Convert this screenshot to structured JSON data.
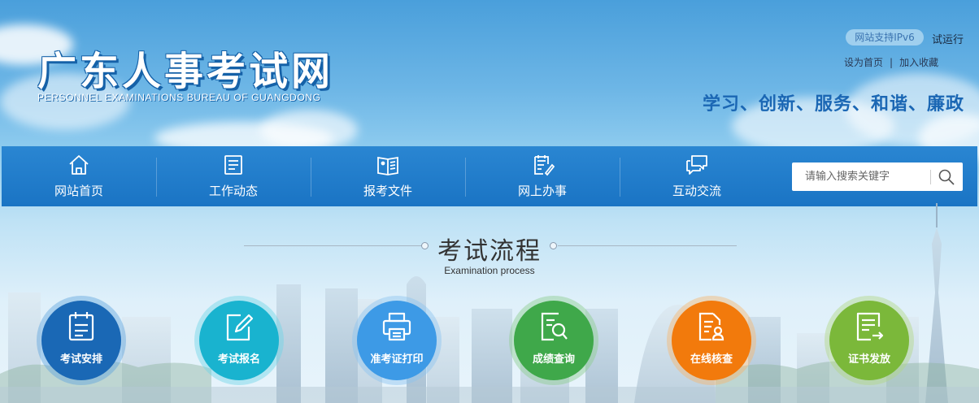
{
  "header": {
    "logo_cn": "广东人事考试网",
    "logo_en": "PERSONNEL EXAMINATIONS BUREAU OF GUANGDONG",
    "ipv6_badge": "网站支持IPv6",
    "trial": "试运行",
    "links": [
      {
        "label": "设为首页"
      },
      {
        "label": "加入收藏"
      }
    ],
    "link_separator": "|",
    "slogan": "学习、创新、服务、和谐、廉政"
  },
  "nav": {
    "items": [
      {
        "label": "网站首页",
        "icon": "home-icon"
      },
      {
        "label": "工作动态",
        "icon": "news-icon"
      },
      {
        "label": "报考文件",
        "icon": "document-icon"
      },
      {
        "label": "网上办事",
        "icon": "online-service-icon"
      },
      {
        "label": "互动交流",
        "icon": "chat-icon"
      }
    ],
    "search": {
      "placeholder": "请输入搜索关键字",
      "value": ""
    }
  },
  "section": {
    "title": "考试流程",
    "subtitle": "Examination process"
  },
  "process": {
    "steps": [
      {
        "label": "考试安排",
        "icon": "calendar-icon",
        "color": "#1a68b5",
        "ring": "#5fa3dd"
      },
      {
        "label": "考试报名",
        "icon": "edit-icon",
        "color": "#19b3cf",
        "ring": "#6fd4e6"
      },
      {
        "label": "准考证打印",
        "icon": "printer-icon",
        "color": "#3d9ae6",
        "ring": "#8cc4f0"
      },
      {
        "label": "成绩查询",
        "icon": "score-search-icon",
        "color": "#3fa84a",
        "ring": "#8ccd8e"
      },
      {
        "label": "在线核查",
        "icon": "verify-icon",
        "color": "#f27a0c",
        "ring": "#f6b56e"
      },
      {
        "label": "证书发放",
        "icon": "certificate-icon",
        "color": "#7bb83a",
        "ring": "#b2d886"
      }
    ]
  },
  "colors": {
    "nav_bg": "#1a74c4",
    "slogan": "#1b67b4",
    "logo_outline": "#1561a8"
  }
}
